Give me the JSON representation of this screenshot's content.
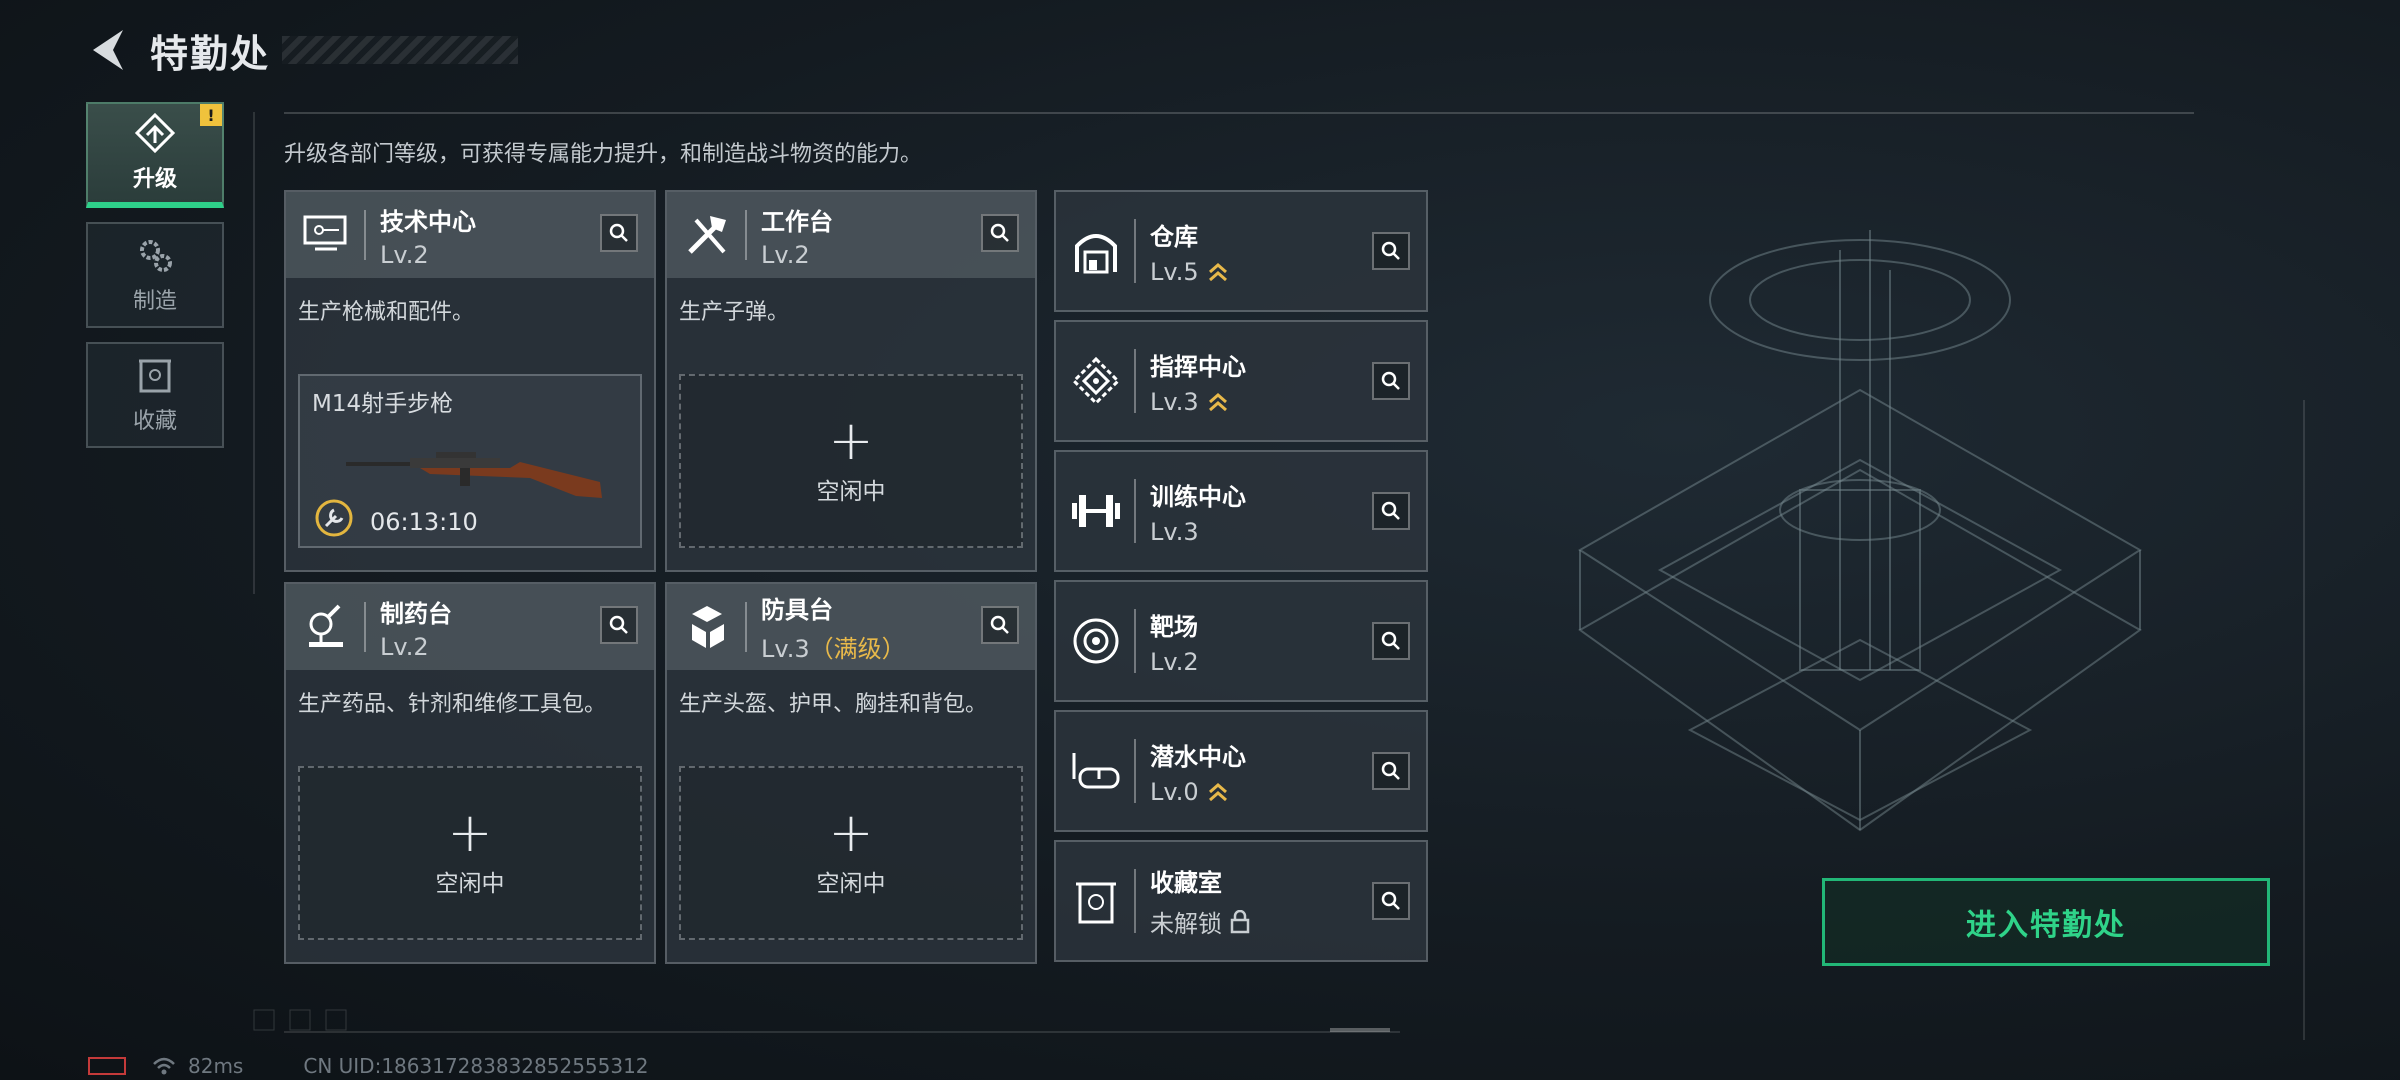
{
  "header": {
    "title": "特勤处"
  },
  "side_tabs": [
    {
      "label": "升级",
      "icon": "upgrade-icon",
      "active": true,
      "badge": "!"
    },
    {
      "label": "制造",
      "icon": "gears-icon",
      "active": false
    },
    {
      "label": "收藏",
      "icon": "collection-icon",
      "active": false
    }
  ],
  "description": "升级各部门等级，可获得专属能力提升，和制造战斗物资的能力。",
  "cards": [
    {
      "name": "技术中心",
      "level": "Lv.2",
      "desc": "生产枪械和配件。",
      "icon": "tech-center-icon",
      "crafting": {
        "item": "M14射手步枪",
        "timer": "06:13:10"
      }
    },
    {
      "name": "工作台",
      "level": "Lv.2",
      "desc": "生产子弹。",
      "icon": "workbench-icon",
      "idle": {
        "plus": "+",
        "label": "空闲中"
      }
    },
    {
      "name": "制药台",
      "level": "Lv.2",
      "desc": "生产药品、针剂和维修工具包。",
      "icon": "pharmacy-icon",
      "idle": {
        "plus": "+",
        "label": "空闲中"
      }
    },
    {
      "name": "防具台",
      "level": "Lv.3",
      "level_note": "（满级）",
      "desc": "生产头盔、护甲、胸挂和背包。",
      "icon": "armor-icon",
      "idle": {
        "plus": "+",
        "label": "空闲中"
      }
    }
  ],
  "small_cards": [
    {
      "name": "仓库",
      "level": "Lv.5",
      "upgradable": true,
      "icon": "warehouse-icon"
    },
    {
      "name": "指挥中心",
      "level": "Lv.3",
      "upgradable": true,
      "icon": "command-center-icon"
    },
    {
      "name": "训练中心",
      "level": "Lv.3",
      "upgradable": false,
      "icon": "dumbbell-icon"
    },
    {
      "name": "靶场",
      "level": "Lv.2",
      "upgradable": false,
      "icon": "target-icon"
    },
    {
      "name": "潜水中心",
      "level": "Lv.0",
      "upgradable": true,
      "icon": "diving-mask-icon"
    },
    {
      "name": "收藏室",
      "level": "未解锁",
      "locked": true,
      "icon": "collection-room-icon"
    }
  ],
  "enter_button": "进入特勤处",
  "footer": {
    "ping": "82ms",
    "uid": "CN UID:1863172838328525553​12"
  },
  "colors": {
    "accent": "#2fd389",
    "max_level": "#e8b94a",
    "alert": "#f0c23c",
    "battery": "#c43a3a"
  }
}
